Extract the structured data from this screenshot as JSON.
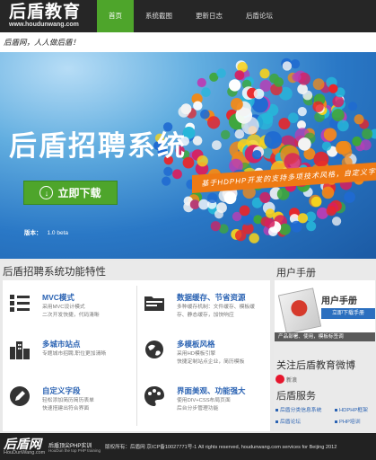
{
  "header": {
    "logo_title": "后盾教育",
    "logo_url": "www.houdunwang.com",
    "nav": [
      {
        "label": "首页",
        "active": true
      },
      {
        "label": "系统截图",
        "active": false
      },
      {
        "label": "更新日志",
        "active": false
      },
      {
        "label": "后盾论坛",
        "active": false
      }
    ],
    "slogan": "后盾网，人人做后盾！"
  },
  "banner": {
    "title": "后盾招聘系统",
    "download_label": "立即下载",
    "version_label": "版本：",
    "version_value": "1.0 beta",
    "ribbon_text": "基于HDPHP开发的支持多项技术风格，自定义字段的"
  },
  "features": {
    "heading": "后盾招聘系统功能特性",
    "items": [
      {
        "title": "MVC模式",
        "desc": "采用MVC设计模式\n二次开发快捷，代码清晰",
        "icon": "list-icon"
      },
      {
        "title": "数据缓存、节省资源",
        "desc": "多种缓存机制：文件缓存、模板缓存、静态缓存，加快响应",
        "icon": "folder-icon"
      },
      {
        "title": "多城市站点",
        "desc": "专题城市招聘,职位更加清晰",
        "icon": "city-icon"
      },
      {
        "title": "多模板风格",
        "desc": "采用HD模板引擎\n快捷定制站点企业，简历模板",
        "icon": "globe-icon"
      },
      {
        "title": "自定义字段",
        "desc": "轻松添加简历简历表单\n快速搭建出符合界面",
        "icon": "pencil-icon"
      },
      {
        "title": "界面美观、功能强大",
        "desc": "使用DIV+CSS布局页面\n后台分步管理功能",
        "icon": "palette-icon"
      }
    ]
  },
  "sidebar": {
    "manual_heading": "用户手册",
    "manual_title": "用户手册",
    "manual_button": "立即下载手册",
    "manual_sub": "产品部署、使用，模板标签调",
    "weibo_heading": "关注后盾教育微博",
    "weibo_label": "新浪",
    "service_heading": "后盾服务",
    "services": [
      "后盾分类信息系统",
      "HDPHP框架",
      "后盾论坛",
      "PHP培训"
    ]
  },
  "footer": {
    "logo": "后盾网",
    "url": "HouDunWang.com",
    "tagline": "后盾顶尖PHP实训",
    "tagline_sub": "HouDun the top PHP training",
    "copyright": "版权所有：后盾网 京ICP备10027771号-1 All rights reserved, houdunwang.com services for Beijing 2012"
  },
  "colors": {
    "accent_green": "#4ea52b",
    "link_blue": "#2b63b3",
    "ribbon_orange": "#ee7a14",
    "header_dark": "#262626"
  }
}
